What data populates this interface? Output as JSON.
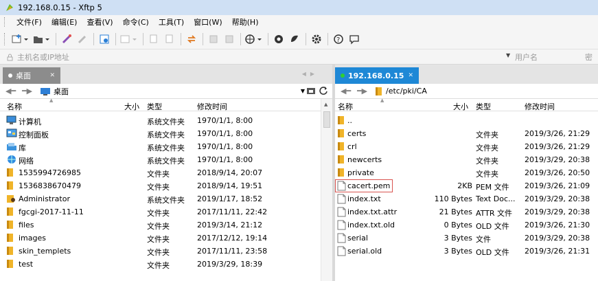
{
  "window": {
    "title": "192.168.0.15   - Xftp 5"
  },
  "menu": [
    "文件(F)",
    "编辑(E)",
    "查看(V)",
    "命令(C)",
    "工具(T)",
    "窗口(W)",
    "帮助(H)"
  ],
  "address": {
    "placeholder": "主机名或IP地址",
    "user_placeholder": "用户名",
    "pwd_placeholder": "密码"
  },
  "colors": {
    "tab_active": "#1e88d6",
    "tab_inactive": "#8c8c8c",
    "folder": "#f0b429",
    "highlight_box": "#d9534f"
  },
  "left_pane": {
    "tab_label": "桌面",
    "path": "桌面",
    "columns": {
      "name": "名称",
      "size": "大小",
      "type": "类型",
      "modified": "修改时间"
    },
    "rows": [
      {
        "icon": "computer-icon",
        "name": "计算机",
        "size": "",
        "type": "系统文件夹",
        "modified": "1970/1/1, 8:00"
      },
      {
        "icon": "control-panel-icon",
        "name": "控制面板",
        "size": "",
        "type": "系统文件夹",
        "modified": "1970/1/1, 8:00"
      },
      {
        "icon": "library-icon",
        "name": "库",
        "size": "",
        "type": "系统文件夹",
        "modified": "1970/1/1, 8:00"
      },
      {
        "icon": "network-icon",
        "name": "网络",
        "size": "",
        "type": "系统文件夹",
        "modified": "1970/1/1, 8:00"
      },
      {
        "icon": "folder-icon",
        "name": "1535994726985",
        "size": "",
        "type": "文件夹",
        "modified": "2018/9/14, 20:07"
      },
      {
        "icon": "folder-icon",
        "name": "1536838670479",
        "size": "",
        "type": "文件夹",
        "modified": "2018/9/14, 19:51"
      },
      {
        "icon": "user-folder-icon",
        "name": "Administrator",
        "size": "",
        "type": "系统文件夹",
        "modified": "2019/1/17, 18:52"
      },
      {
        "icon": "folder-icon",
        "name": "fgcgi-2017-11-11",
        "size": "",
        "type": "文件夹",
        "modified": "2017/11/11, 22:42"
      },
      {
        "icon": "folder-icon",
        "name": "files",
        "size": "",
        "type": "文件夹",
        "modified": "2019/3/14, 21:12"
      },
      {
        "icon": "folder-icon",
        "name": "images",
        "size": "",
        "type": "文件夹",
        "modified": "2017/12/12, 19:14"
      },
      {
        "icon": "folder-icon",
        "name": "skin_templets",
        "size": "",
        "type": "文件夹",
        "modified": "2017/11/11, 23:58"
      },
      {
        "icon": "folder-icon",
        "name": "test",
        "size": "",
        "type": "文件夹",
        "modified": "2019/3/29, 18:39"
      }
    ]
  },
  "right_pane": {
    "tab_label": "192.168.0.15",
    "path": "/etc/pki/CA",
    "columns": {
      "name": "名称",
      "size": "大小",
      "type": "类型",
      "modified": "修改时间"
    },
    "rows": [
      {
        "icon": "folder-icon",
        "name": "..",
        "size": "",
        "type": "",
        "modified": ""
      },
      {
        "icon": "folder-icon",
        "name": "certs",
        "size": "",
        "type": "文件夹",
        "modified": "2019/3/26, 21:29"
      },
      {
        "icon": "folder-icon",
        "name": "crl",
        "size": "",
        "type": "文件夹",
        "modified": "2019/3/26, 21:29"
      },
      {
        "icon": "folder-icon",
        "name": "newcerts",
        "size": "",
        "type": "文件夹",
        "modified": "2019/3/29, 20:38"
      },
      {
        "icon": "folder-icon",
        "name": "private",
        "size": "",
        "type": "文件夹",
        "modified": "2019/3/26, 20:50"
      },
      {
        "icon": "file-icon",
        "name": "cacert.pem",
        "size": "2KB",
        "type": "PEM 文件",
        "modified": "2019/3/26, 21:09"
      },
      {
        "icon": "file-icon",
        "name": "index.txt",
        "size": "110 Bytes",
        "type": "Text Doc...",
        "modified": "2019/3/29, 20:38"
      },
      {
        "icon": "file-icon",
        "name": "index.txt.attr",
        "size": "21 Bytes",
        "type": "ATTR 文件",
        "modified": "2019/3/29, 20:38"
      },
      {
        "icon": "file-icon",
        "name": "index.txt.old",
        "size": "0 Bytes",
        "type": "OLD 文件",
        "modified": "2019/3/26, 21:30"
      },
      {
        "icon": "file-icon",
        "name": "serial",
        "size": "3 Bytes",
        "type": "文件",
        "modified": "2019/3/29, 20:38"
      },
      {
        "icon": "file-icon",
        "name": "serial.old",
        "size": "3 Bytes",
        "type": "OLD 文件",
        "modified": "2019/3/26, 21:31"
      }
    ]
  }
}
